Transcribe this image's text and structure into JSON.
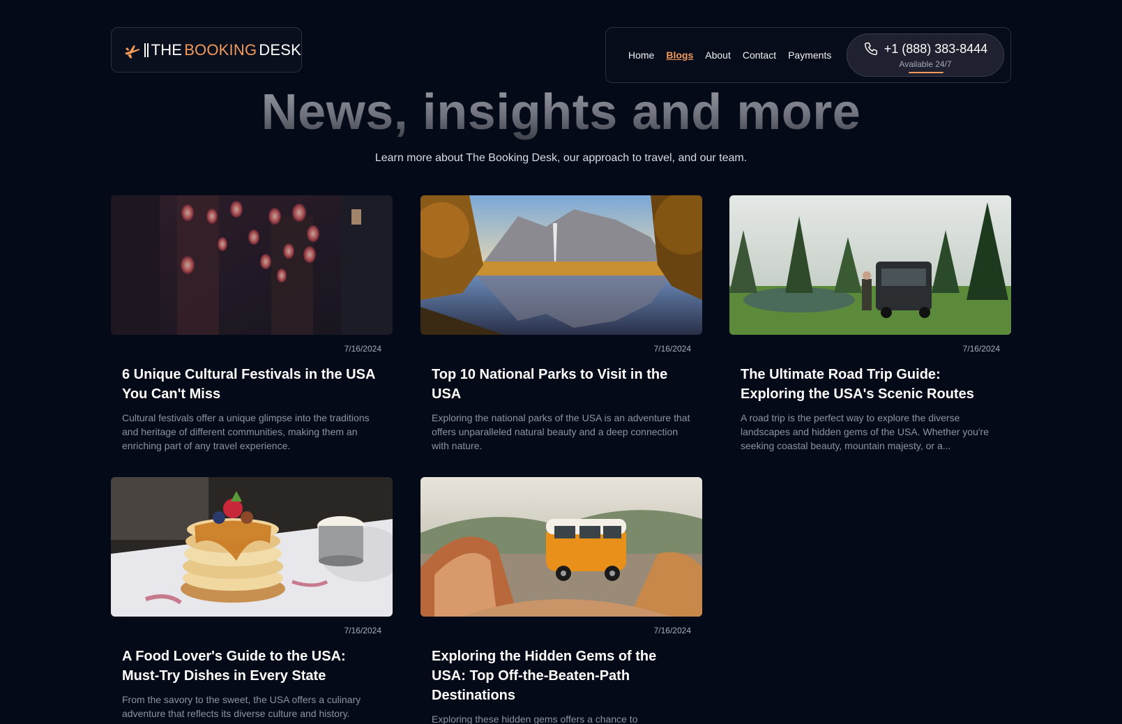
{
  "brand": {
    "logo_the": "THE",
    "logo_booking": "BOOKING",
    "logo_desk": "DESK",
    "accent_color": "#f09a5c",
    "background_color": "#050a18"
  },
  "nav": {
    "items": [
      {
        "label": "Home",
        "active": false
      },
      {
        "label": "Blogs",
        "active": true
      },
      {
        "label": "About",
        "active": false
      },
      {
        "label": "Contact",
        "active": false
      },
      {
        "label": "Payments",
        "active": false
      }
    ],
    "phone": "+1 (888) 383-8444",
    "phone_sub": "Available 24/7",
    "phone_icon": "phone-icon"
  },
  "hero": {
    "title": "News, insights and more",
    "subtitle": "Learn more about The Booking Desk, our approach to travel, and our team."
  },
  "posts": [
    {
      "date": "7/16/2024",
      "title": "6 Unique Cultural Festivals in the USA You Can't Miss",
      "description": "Cultural festivals offer a unique glimpse into the traditions and heritage of different communities, making them an enriching part of any travel experience.",
      "image": "lantern-street-photo"
    },
    {
      "date": "7/16/2024",
      "title": "Top 10 National Parks to Visit in the USA",
      "description": "Exploring the national parks of the USA is an adventure that offers unparalleled natural beauty and a deep connection with nature.",
      "image": "yosemite-valley-photo"
    },
    {
      "date": "7/16/2024",
      "title": "The Ultimate Road Trip Guide: Exploring the USA's Scenic Routes",
      "description": "A road trip is the perfect way to explore the diverse landscapes and hidden gems of the USA. Whether you're seeking coastal beauty, mountain majesty, or a...",
      "image": "camper-van-forest-photo"
    },
    {
      "date": "7/16/2024",
      "title": "A Food Lover's Guide to the USA: Must-Try Dishes in Every State",
      "description": "From the savory to the sweet, the USA offers a culinary adventure that reflects its diverse culture and history.",
      "image": "pancakes-photo"
    },
    {
      "date": "7/16/2024",
      "title": "Exploring the Hidden Gems of the USA: Top Off-the-Beaten-Path Destinations",
      "description": "Exploring these hidden gems offers a chance to",
      "image": "orange-van-photo"
    }
  ]
}
